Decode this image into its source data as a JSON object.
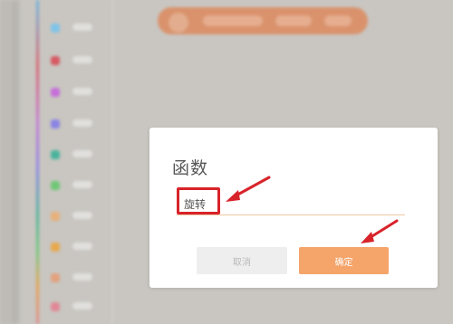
{
  "dialog": {
    "title": "函数",
    "input_value": "旋转",
    "cancel_label": "取消",
    "ok_label": "确定"
  },
  "colors": {
    "accent": "#f5a46a",
    "annotation": "#d8232a",
    "backdrop": "#c9c6c1"
  },
  "sidebar": {
    "categories": [
      {
        "color": "#7fc3e8"
      },
      {
        "color": "#d65a63"
      },
      {
        "color": "#c56fd9"
      },
      {
        "color": "#8a83e3"
      },
      {
        "color": "#49b39b"
      },
      {
        "color": "#6fc776"
      },
      {
        "color": "#e7b07a"
      },
      {
        "color": "#e7a84d"
      },
      {
        "color": "#e2a27e"
      },
      {
        "color": "#e08895"
      }
    ]
  }
}
